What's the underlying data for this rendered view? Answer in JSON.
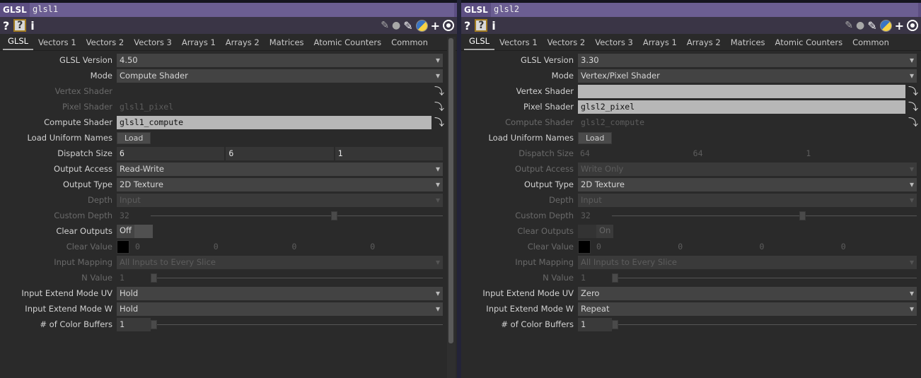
{
  "left": {
    "op_type": "GLSL",
    "op_name": "glsl1",
    "tabs": [
      "GLSL",
      "Vectors 1",
      "Vectors 2",
      "Vectors 3",
      "Arrays 1",
      "Arrays 2",
      "Matrices",
      "Atomic Counters",
      "Common"
    ],
    "active_tab": "GLSL",
    "glsl_version": {
      "label": "GLSL Version",
      "value": "4.50"
    },
    "mode": {
      "label": "Mode",
      "value": "Compute Shader"
    },
    "vertex_shader": {
      "label": "Vertex Shader",
      "value": ""
    },
    "pixel_shader": {
      "label": "Pixel Shader",
      "value": "glsl1_pixel"
    },
    "compute_shader": {
      "label": "Compute Shader",
      "value": "glsl1_compute"
    },
    "load_uniform": {
      "label": "Load Uniform Names",
      "button": "Load"
    },
    "dispatch_size": {
      "label": "Dispatch Size",
      "values": [
        "6",
        "6",
        "1"
      ]
    },
    "output_access": {
      "label": "Output Access",
      "value": "Read-Write"
    },
    "output_type": {
      "label": "Output Type",
      "value": "2D Texture"
    },
    "depth": {
      "label": "Depth",
      "value": "Input"
    },
    "custom_depth": {
      "label": "Custom Depth",
      "value": "32"
    },
    "clear_outputs": {
      "label": "Clear Outputs",
      "value": "Off"
    },
    "clear_value": {
      "label": "Clear Value",
      "values": [
        "0",
        "0",
        "0",
        "0"
      ]
    },
    "input_mapping": {
      "label": "Input Mapping",
      "value": "All Inputs to Every Slice"
    },
    "n_value": {
      "label": "N Value",
      "value": "1"
    },
    "extend_uv": {
      "label": "Input Extend Mode UV",
      "value": "Hold"
    },
    "extend_w": {
      "label": "Input Extend Mode W",
      "value": "Hold"
    },
    "color_buffers": {
      "label": "# of Color Buffers",
      "value": "1"
    }
  },
  "right": {
    "op_type": "GLSL",
    "op_name": "glsl2",
    "tabs": [
      "GLSL",
      "Vectors 1",
      "Vectors 2",
      "Vectors 3",
      "Arrays 1",
      "Arrays 2",
      "Matrices",
      "Atomic Counters",
      "Common"
    ],
    "active_tab": "GLSL",
    "glsl_version": {
      "label": "GLSL Version",
      "value": "3.30"
    },
    "mode": {
      "label": "Mode",
      "value": "Vertex/Pixel Shader"
    },
    "vertex_shader": {
      "label": "Vertex Shader",
      "value": ""
    },
    "pixel_shader": {
      "label": "Pixel Shader",
      "value": "glsl2_pixel"
    },
    "compute_shader": {
      "label": "Compute Shader",
      "value": "glsl2_compute"
    },
    "load_uniform": {
      "label": "Load Uniform Names",
      "button": "Load"
    },
    "dispatch_size": {
      "label": "Dispatch Size",
      "values": [
        "64",
        "64",
        "1"
      ]
    },
    "output_access": {
      "label": "Output Access",
      "value": "Write Only"
    },
    "output_type": {
      "label": "Output Type",
      "value": "2D Texture"
    },
    "depth": {
      "label": "Depth",
      "value": "Input"
    },
    "custom_depth": {
      "label": "Custom Depth",
      "value": "32"
    },
    "clear_outputs": {
      "label": "Clear Outputs",
      "value": "On"
    },
    "clear_value": {
      "label": "Clear Value",
      "values": [
        "0",
        "0",
        "0",
        "0"
      ]
    },
    "input_mapping": {
      "label": "Input Mapping",
      "value": "All Inputs to Every Slice"
    },
    "n_value": {
      "label": "N Value",
      "value": "1"
    },
    "extend_uv": {
      "label": "Input Extend Mode UV",
      "value": "Zero"
    },
    "extend_w": {
      "label": "Input Extend Mode W",
      "value": "Repeat"
    },
    "color_buffers": {
      "label": "# of Color Buffers",
      "value": "1"
    }
  },
  "icons": {
    "help": "?",
    "info": "i",
    "add": "+"
  }
}
